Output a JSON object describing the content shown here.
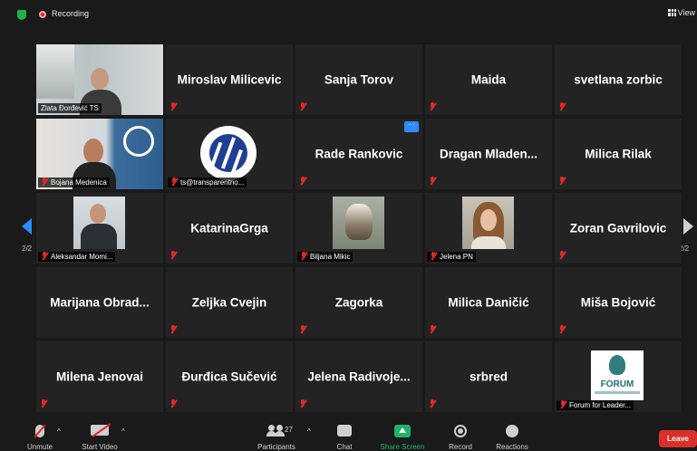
{
  "topbar": {
    "recording_label": "Recording",
    "view_label": "View"
  },
  "gallery": {
    "page_indicator": "2/2",
    "tiles": {
      "zlata": {
        "label": "Zlata Đorđević TS"
      },
      "miroslav": {
        "name": "Miroslav Milicevic"
      },
      "sanja": {
        "name": "Sanja Torov"
      },
      "maida": {
        "name": "Maida"
      },
      "svetlana": {
        "name": "svetlana zorbic"
      },
      "bojana": {
        "label": "Bojana Medenica"
      },
      "ts": {
        "label": "ts@transparentno..."
      },
      "rade": {
        "name": "Rade Rankovic",
        "badge": "···"
      },
      "dragan": {
        "name": "Dragan  Mladen..."
      },
      "milica_r": {
        "name": "Milica Rilak"
      },
      "aleksandar": {
        "label": "Aleksandar Momi..."
      },
      "katarina": {
        "name": "KatarinaGrga"
      },
      "biljana": {
        "label": "Biljana Mikic"
      },
      "jelena_pn": {
        "label": "Jelena PN"
      },
      "zoran": {
        "name": "Zoran Gavrilovic"
      },
      "marijana": {
        "name": "Marijana  Obrad..."
      },
      "zeljka": {
        "name": "Zeljka Cvejin"
      },
      "zagorka": {
        "name": "Zagorka"
      },
      "milica_d": {
        "name": "Milica Daničić"
      },
      "misa": {
        "name": "Miša Bojović"
      },
      "milena": {
        "name": "Milena Jenovai"
      },
      "djurdjica": {
        "name": "Đurđica Sučević"
      },
      "jelena_r": {
        "name": "Jelena  Radivoje..."
      },
      "srbred": {
        "name": "srbred"
      },
      "forum": {
        "label": "Forum for Leader...",
        "logo_text": "FORUM"
      }
    }
  },
  "toolbar": {
    "unmute": "Unmute",
    "start_video": "Start Video",
    "participants": "Participants",
    "participants_count": "27",
    "chat": "Chat",
    "share_screen": "Share Screen",
    "record": "Record",
    "reactions": "Reactions",
    "leave": "Leave"
  },
  "colors": {
    "accent": "#2d8cff",
    "active_speaker": "#c6e35a",
    "muted": "#e02828",
    "share": "#1fb26b",
    "leave": "#d9302a"
  }
}
